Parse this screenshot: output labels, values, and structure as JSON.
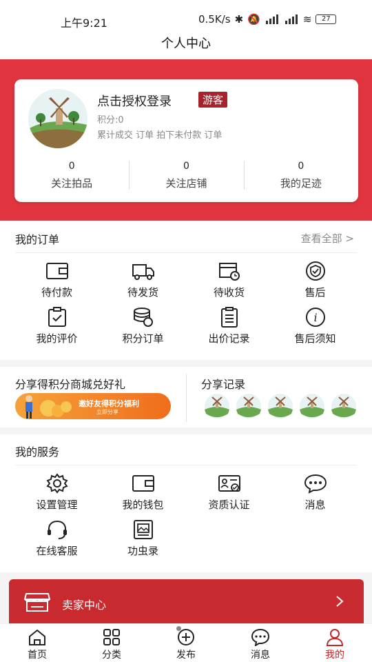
{
  "status_bar": {
    "time": "上午9:21",
    "speed": "0.5K/s",
    "battery": "27"
  },
  "navbar": {
    "title": "个人中心"
  },
  "user": {
    "login_text": "点击授权登录",
    "badge": "游客",
    "points": "积分:0",
    "stats_text": "累计成交 订单   拍下未付款 订单",
    "counts": [
      {
        "value": "0",
        "label": "关注拍品"
      },
      {
        "value": "0",
        "label": "关注店铺"
      },
      {
        "value": "0",
        "label": "我的足迹"
      }
    ]
  },
  "orders": {
    "title": "我的订单",
    "view_all": "查看全部 >",
    "items": [
      {
        "label": "待付款",
        "icon": "wallet-icon"
      },
      {
        "label": "待发货",
        "icon": "delivery-truck-icon"
      },
      {
        "label": "待收货",
        "icon": "receive-box-icon"
      },
      {
        "label": "售后",
        "icon": "shield-check-icon"
      },
      {
        "label": "我的评价",
        "icon": "clipboard-check-icon"
      },
      {
        "label": "积分订单",
        "icon": "coin-stack-icon"
      },
      {
        "label": "出价记录",
        "icon": "document-list-icon"
      },
      {
        "label": "售后须知",
        "icon": "info-icon"
      }
    ]
  },
  "share": {
    "left_title": "分享得积分商城兑好礼",
    "promo_text": "邀好友得积分福利",
    "promo_sub": "立即分享",
    "right_title": "分享记录"
  },
  "services": {
    "title": "我的服务",
    "items": [
      {
        "label": "设置管理",
        "icon": "gear-icon"
      },
      {
        "label": "我的钱包",
        "icon": "wallet-icon"
      },
      {
        "label": "资质认证",
        "icon": "id-card-icon"
      },
      {
        "label": "消息",
        "icon": "chat-bubble-icon"
      },
      {
        "label": "在线客服",
        "icon": "headset-icon"
      },
      {
        "label": "功虫录",
        "icon": "picture-frame-icon"
      }
    ]
  },
  "seller": {
    "label": "卖家中心"
  },
  "tabs": [
    {
      "label": "首页",
      "icon": "home-icon"
    },
    {
      "label": "分类",
      "icon": "grid-icon"
    },
    {
      "label": "发布",
      "icon": "plus-circle-icon"
    },
    {
      "label": "消息",
      "icon": "chat-bubble-icon"
    },
    {
      "label": "我的",
      "icon": "user-icon"
    }
  ],
  "colors": {
    "brand_red": "#e0353f",
    "dark_red": "#c92a2f",
    "badge_red": "#a7232b"
  }
}
